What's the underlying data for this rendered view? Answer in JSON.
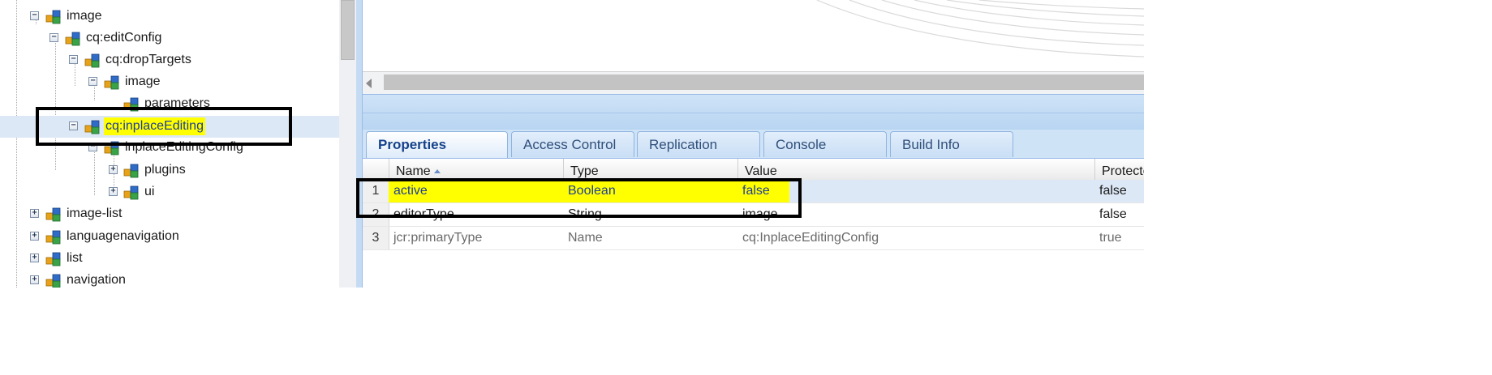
{
  "tree": {
    "nodes": [
      {
        "id": "image",
        "label": "image",
        "toggle": "−"
      },
      {
        "id": "cq-editconfig",
        "label": "cq:editConfig",
        "toggle": "−"
      },
      {
        "id": "cq-droptargets",
        "label": "cq:dropTargets",
        "toggle": "−"
      },
      {
        "id": "image-2",
        "label": "image",
        "toggle": "−"
      },
      {
        "id": "parameters",
        "label": "parameters",
        "toggle": ""
      },
      {
        "id": "cq-inplaceediting",
        "label": "cq:inplaceEditing",
        "toggle": "−",
        "selected": true
      },
      {
        "id": "inplaceeditingconfig",
        "label": "inplaceEditingConfig",
        "toggle": "−"
      },
      {
        "id": "plugins",
        "label": "plugins",
        "toggle": "+"
      },
      {
        "id": "ui",
        "label": "ui",
        "toggle": "+"
      },
      {
        "id": "image-list",
        "label": "image-list",
        "toggle": "+"
      },
      {
        "id": "languagenavigation",
        "label": "languagenavigation",
        "toggle": "+"
      },
      {
        "id": "list",
        "label": "list",
        "toggle": "+"
      },
      {
        "id": "navigation",
        "label": "navigation",
        "toggle": "+"
      }
    ]
  },
  "tabs": [
    {
      "label": "Properties",
      "active": true
    },
    {
      "label": "Access Control"
    },
    {
      "label": "Replication"
    },
    {
      "label": "Console"
    },
    {
      "label": "Build Info"
    }
  ],
  "grid": {
    "columns": [
      "Name",
      "Type",
      "Value",
      "Protecte"
    ],
    "rows": [
      {
        "num": "1",
        "name": "active",
        "type": "Boolean",
        "value": "false",
        "protected": "false"
      },
      {
        "num": "2",
        "name": "editorType",
        "type": "String",
        "value": "image",
        "protected": "false"
      },
      {
        "num": "3",
        "name": "jcr:primaryType",
        "type": "Name",
        "value": "cq:InplaceEditingConfig",
        "protected": "true"
      }
    ]
  },
  "colors": {
    "highlight": "#ffff00",
    "selection": "#dde8f6",
    "tab_text": "#15428b"
  },
  "icons": {
    "node": "node-cubes-icon",
    "sort": "sort-ascending-icon",
    "scroll_left": "scroll-left-arrow-icon"
  }
}
